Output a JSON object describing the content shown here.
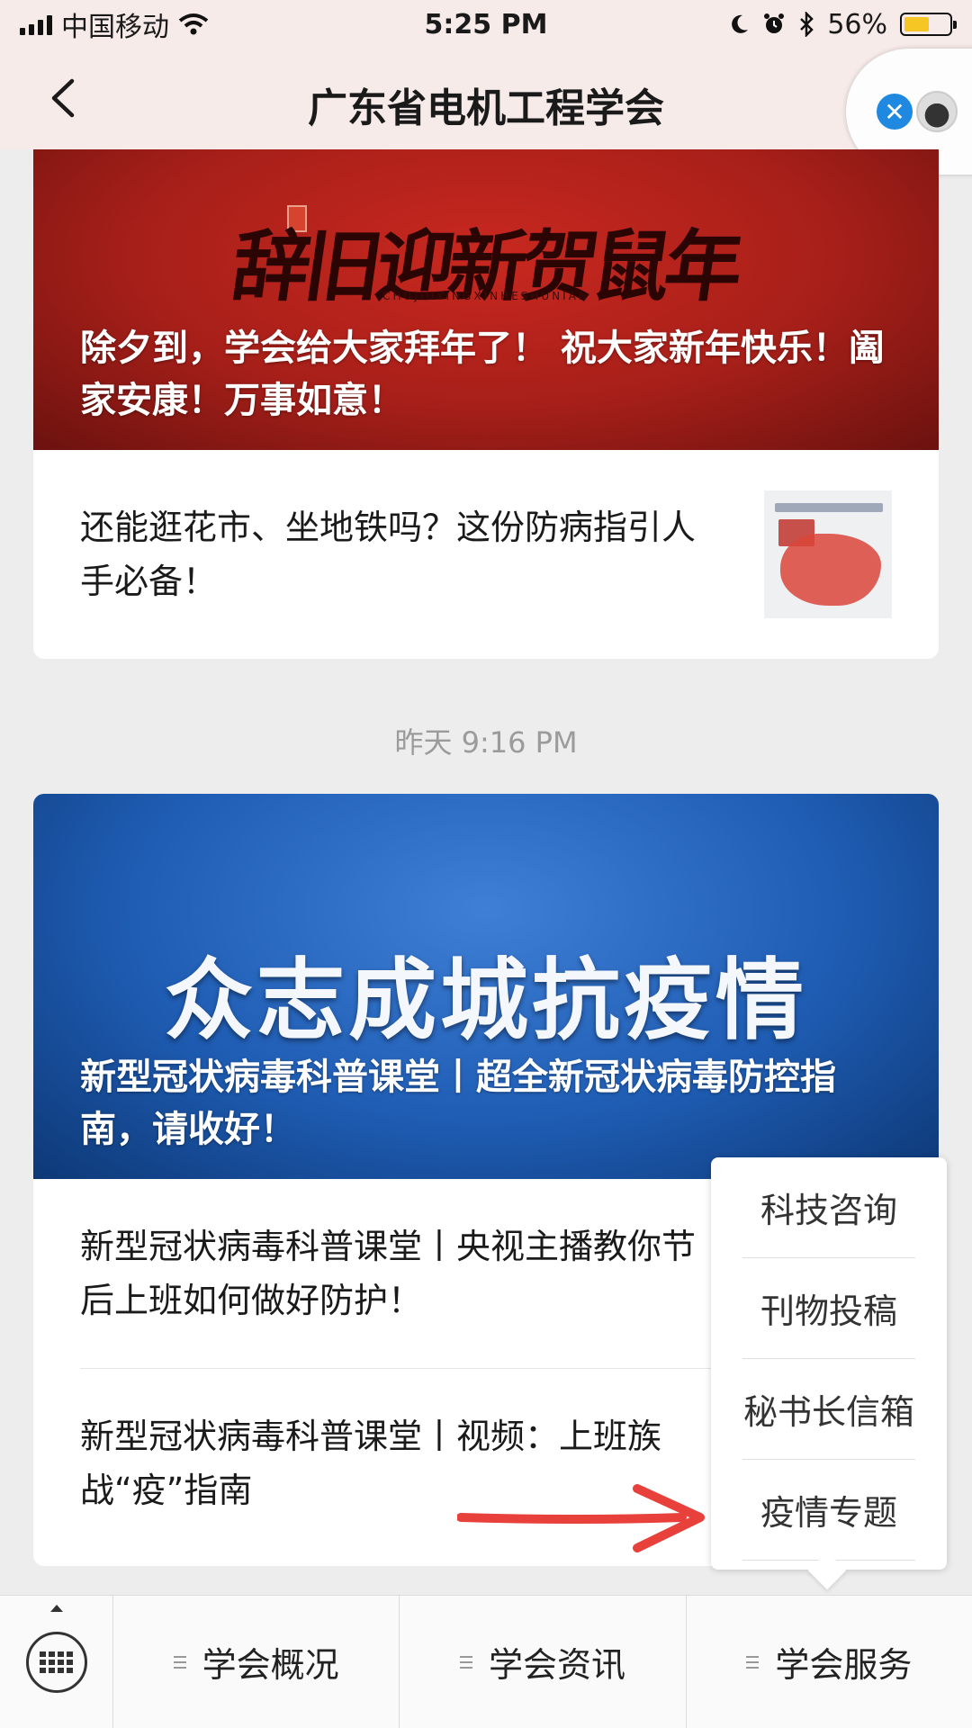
{
  "status_bar": {
    "carrier": "中国移动",
    "time": "5:25 PM",
    "battery_percent": "56%",
    "battery_level": 0.56,
    "battery_color": "#f6c624",
    "icons": [
      "signal-icon",
      "wifi-icon",
      "moon-icon",
      "alarm-icon",
      "bluetooth-icon",
      "battery-icon"
    ]
  },
  "nav": {
    "title": "广东省电机工程学会",
    "back_icon": "chevron-left-icon",
    "capsule_close": "✕"
  },
  "card1": {
    "cover_art": "辞旧迎新贺鼠年",
    "cover_art_sub": "CHUJIUYINGXINHESHUNIAN",
    "cover_title": "除夕到，学会给大家拜年了！ 祝大家新年快乐！阖家安康！万事如意！",
    "sub_title": "还能逛花市、坐地铁吗？这份防病指引人手必备！"
  },
  "timestamp": "昨天 9:16 PM",
  "card2": {
    "cover_art": "众志成城抗疫情",
    "cover_title": "新型冠状病毒科普课堂丨超全新冠状病毒防控指南，请收好！",
    "items": [
      {
        "title": "新型冠状病毒科普课堂丨央视主播教你节后上班如何做好防护！"
      },
      {
        "title": "新型冠状病毒科普课堂丨视频：上班族战“疫”指南"
      }
    ]
  },
  "popup_menu": {
    "items": [
      "科技咨询",
      "刊物投稿",
      "秘书长信箱",
      "疫情专题"
    ]
  },
  "annotation_arrow_color": "#e8403a",
  "bottom_menu": {
    "keyboard_icon": "keyboard-icon",
    "tabs": [
      "学会概况",
      "学会资讯",
      "学会服务"
    ]
  }
}
